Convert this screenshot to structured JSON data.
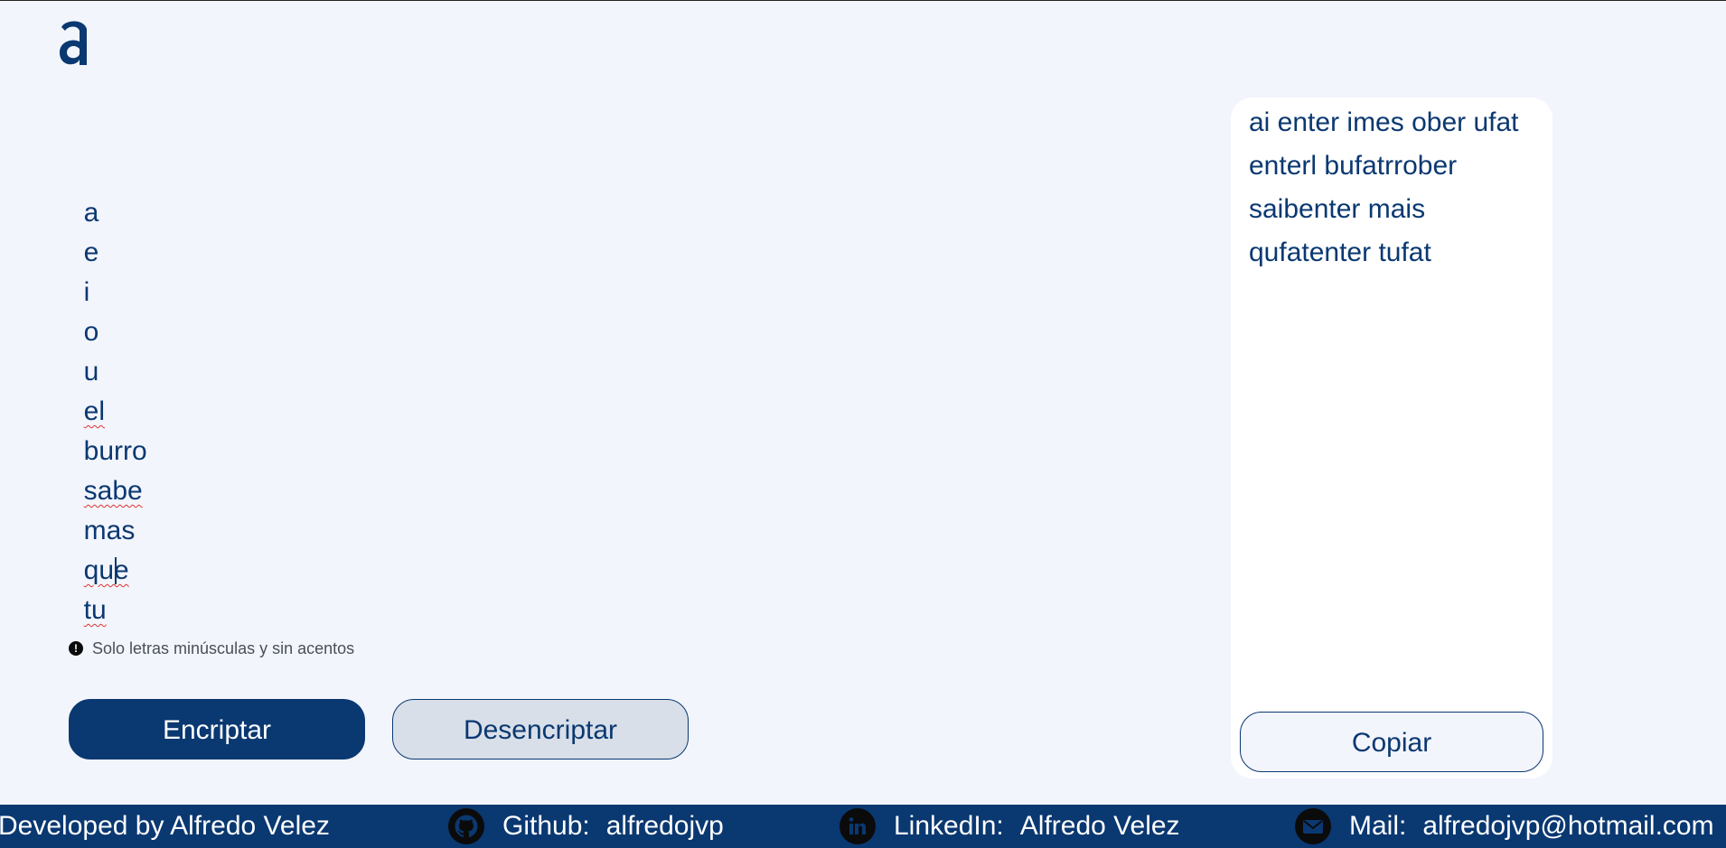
{
  "app": {
    "logo_icon": "alura-a-logo-icon"
  },
  "input": {
    "value_words": [
      "a",
      "e",
      "i",
      "o",
      "u",
      "el",
      "burro",
      "sabe",
      "mas",
      "que",
      "tu"
    ],
    "misspelled": [
      "el",
      "sabe",
      "que",
      "tu"
    ]
  },
  "hint": {
    "icon": "exclamation-circle-icon",
    "text": "Solo letras minúsculas y sin acentos"
  },
  "buttons": {
    "encrypt": "Encriptar",
    "decrypt": "Desencriptar",
    "copy": "Copiar"
  },
  "output": {
    "lines": [
      "ai enter imes ober ufat",
      "enterl bufatrrober",
      "saibenter mais",
      "qufatenter tufat"
    ]
  },
  "footer": {
    "developed_by": "Developed by Alfredo Velez",
    "github_label": "Github:",
    "github_value": "alfredojvp",
    "linkedin_label": "LinkedIn:",
    "linkedin_value": "Alfredo Velez",
    "mail_label": "Mail:",
    "mail_value": "alfredojvp@hotmail.com"
  },
  "colors": {
    "brand": "#0a3871",
    "background": "#f3f5fc",
    "panel": "#ffffff"
  }
}
